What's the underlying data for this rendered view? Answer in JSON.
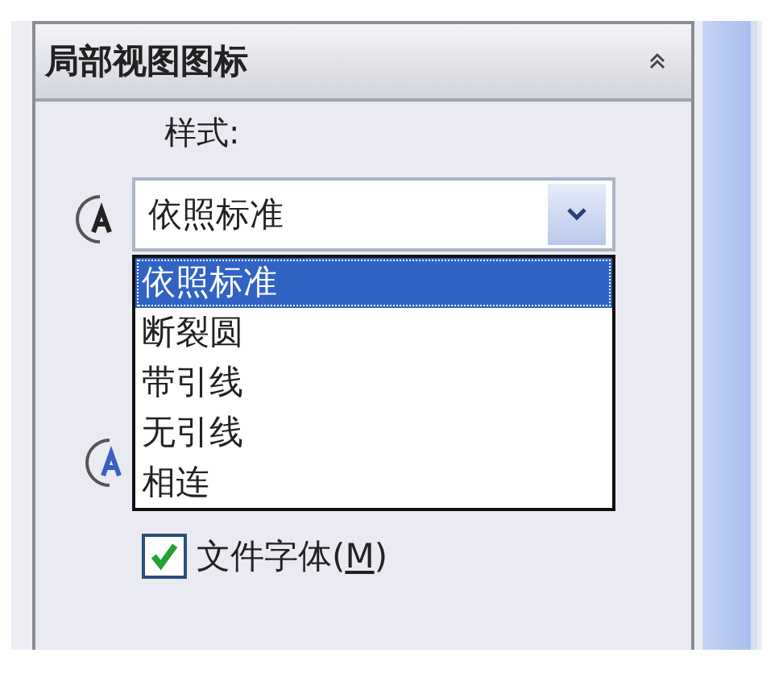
{
  "panel": {
    "title": "局部视图图标",
    "expanded": true
  },
  "style_label": "样式:",
  "combo": {
    "value": "依照标准",
    "open": true
  },
  "options": [
    {
      "label": "依照标准",
      "selected": true
    },
    {
      "label": "断裂圆",
      "selected": false
    },
    {
      "label": "带引线",
      "selected": false
    },
    {
      "label": "无引线",
      "selected": false
    },
    {
      "label": "相连",
      "selected": false
    }
  ],
  "checkbox": {
    "label_start": "文件字体(",
    "mnemonic": "M",
    "label_end": ")",
    "checked": true
  }
}
